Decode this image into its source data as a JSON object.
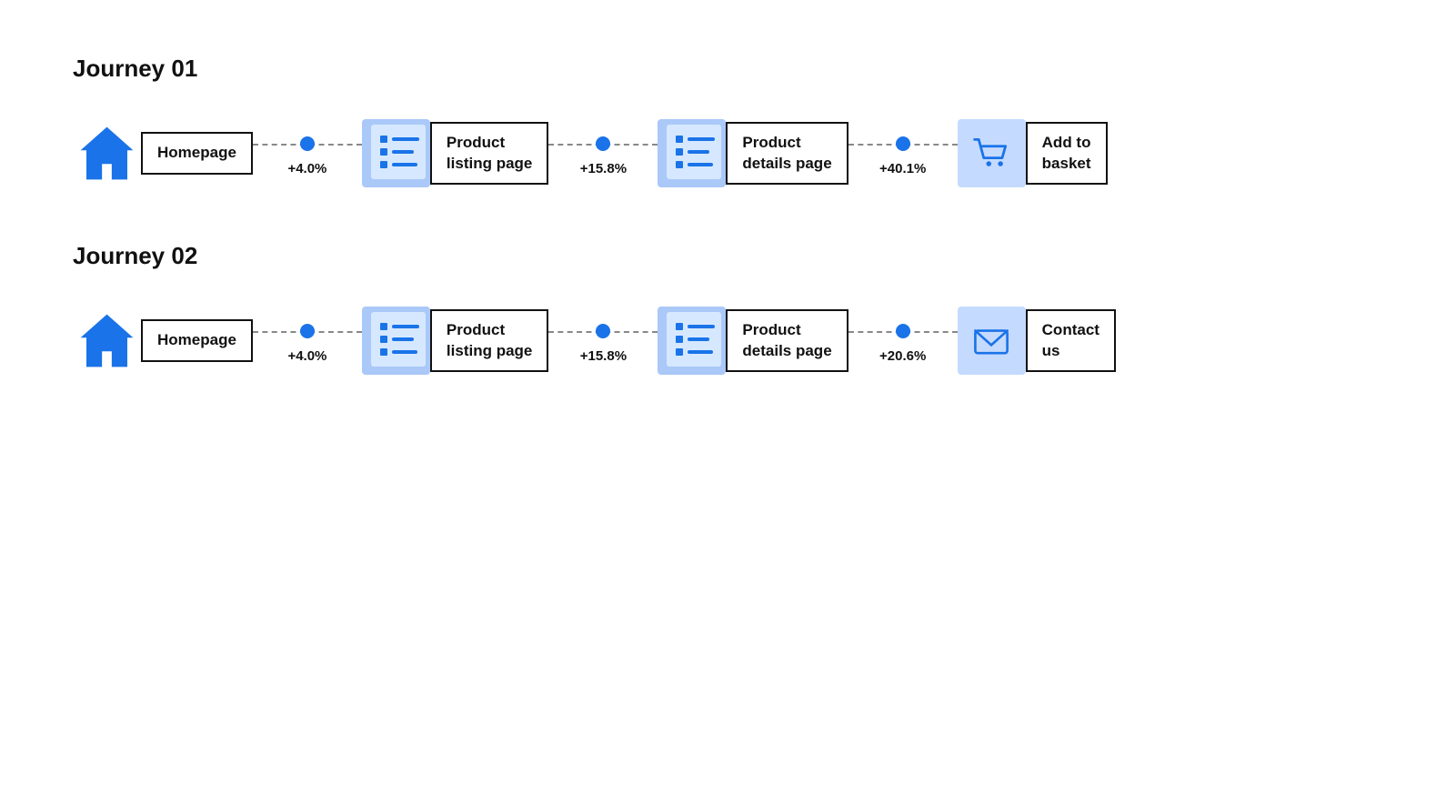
{
  "journeys": [
    {
      "id": "journey-01",
      "title": "Journey 01",
      "nodes": [
        {
          "id": "homepage-1",
          "icon": "home",
          "label": "Homepage"
        },
        {
          "id": "product-listing-1",
          "icon": "page",
          "label": "Product\nlisting page"
        },
        {
          "id": "product-details-1",
          "icon": "page",
          "label": "Product\ndetails page"
        },
        {
          "id": "add-to-basket",
          "icon": "cart",
          "label": "Add to\nbasket"
        }
      ],
      "connectors": [
        {
          "id": "conn-1-1",
          "pct": "+4.0%"
        },
        {
          "id": "conn-1-2",
          "pct": "+15.8%"
        },
        {
          "id": "conn-1-3",
          "pct": "+40.1%"
        }
      ]
    },
    {
      "id": "journey-02",
      "title": "Journey 02",
      "nodes": [
        {
          "id": "homepage-2",
          "icon": "home",
          "label": "Homepage"
        },
        {
          "id": "product-listing-2",
          "icon": "page",
          "label": "Product\nlisting page"
        },
        {
          "id": "product-details-2",
          "icon": "page",
          "label": "Product\ndetails page"
        },
        {
          "id": "contact-us",
          "icon": "envelope",
          "label": "Contact\nus"
        }
      ],
      "connectors": [
        {
          "id": "conn-2-1",
          "pct": "+4.0%"
        },
        {
          "id": "conn-2-2",
          "pct": "+15.8%"
        },
        {
          "id": "conn-2-3",
          "pct": "+20.6%"
        }
      ]
    }
  ]
}
